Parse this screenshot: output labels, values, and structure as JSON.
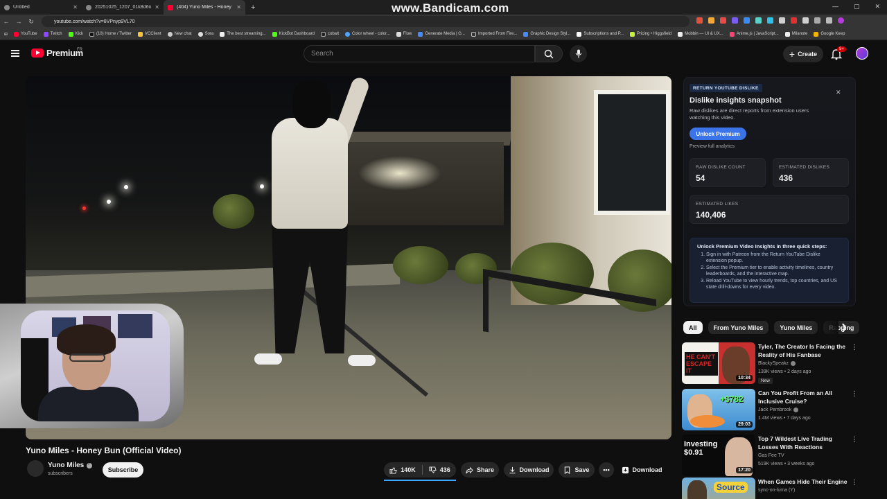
{
  "browser": {
    "tabs": [
      {
        "title": "Untitled",
        "active": false
      },
      {
        "title": "20251025_1207_01k8d6n896e...",
        "active": false
      },
      {
        "title": "(404) Yuno Miles - Honey Bun (",
        "active": true
      }
    ],
    "new_tab": "+",
    "url": "youtube.com/watch?v=8VPnyp9VL70",
    "watermark": "www.Bandicam.com",
    "bookmarks": [
      "YouTube",
      "Twitch",
      "Kick",
      "(10) Home / Twitter",
      "VCClient",
      "New chat",
      "Sora",
      "The best streaming...",
      "KickBot Dashboard",
      "cobalt",
      "Color wheel - color...",
      "Flow",
      "Generate Media | G...",
      "Imported From Fire...",
      "Graphic Design Styl...",
      "Subscriptions and P...",
      "Pricing • Higgsfield",
      "Mobbin — UI & UX...",
      "Anime.js | JavaScript...",
      "Milanote",
      "Google Keep"
    ]
  },
  "header": {
    "logo": "Premium",
    "logo_sup": "FR",
    "search_placeholder": "Search",
    "create_label": "Create",
    "notif_badge": "9+"
  },
  "video": {
    "title": "Yuno Miles - Honey Bun (Official Video)",
    "channel": "Yuno Miles",
    "subs": "subscribers",
    "subscribe_label": "Subscribe",
    "likes": "140K",
    "dislikes": "436",
    "share": "Share",
    "download": "Download",
    "save": "Save",
    "download2": "Download"
  },
  "rtd": {
    "tag": "RETURN YOUTUBE DISLIKE",
    "title": "Dislike insights snapshot",
    "desc": "Raw dislikes are direct reports from extension users watching this video.",
    "unlock": "Unlock Premium",
    "preview": "Preview full analytics",
    "raw_label": "RAW DISLIKE COUNT",
    "raw_val": "54",
    "est_dis_label": "ESTIMATED DISLIKES",
    "est_dis_val": "436",
    "est_likes_label": "ESTIMATED LIKES",
    "est_likes_val": "140,406",
    "steps_title": "Unlock Premium Video Insights in three quick steps:",
    "steps": [
      "Sign in with Patreon from the Return YouTube Dislike extension popup.",
      "Select the Premium tier to enable activity timelines, country leaderboards, and the interactive map.",
      "Reload YouTube to view hourly trends, top countries, and US state drill-downs for every video."
    ]
  },
  "chips": [
    "All",
    "From Yuno Miles",
    "Yuno Miles",
    "Rapping"
  ],
  "recs": [
    {
      "title": "Tyler, The Creator Is Facing the Reality of His Fanbase",
      "channel": "BlackySpeakz",
      "meta": "139K views • 2 days ago",
      "badge": "New",
      "duration": "10:34",
      "thumb_text": "HE CAN'T ESCAPE IT"
    },
    {
      "title": "Can You Profit From an All Inclusive Cruise?",
      "channel": "Jack Pembrook",
      "meta": "1.4M views • 7 days ago",
      "duration": "29:03",
      "thumb_text": "+$782"
    },
    {
      "title": "Top 7 Wildest Live Trading Losses With Reactions",
      "channel": "Gas Fee TV",
      "meta": "519K views • 3 weeks ago",
      "duration": "17:20",
      "thumb_text": "Investing $0.91"
    },
    {
      "title": "When Games Hide Their Engine",
      "channel": "sync-on-luma (Y)",
      "meta": "",
      "duration": "",
      "thumb_text": "Source"
    }
  ]
}
